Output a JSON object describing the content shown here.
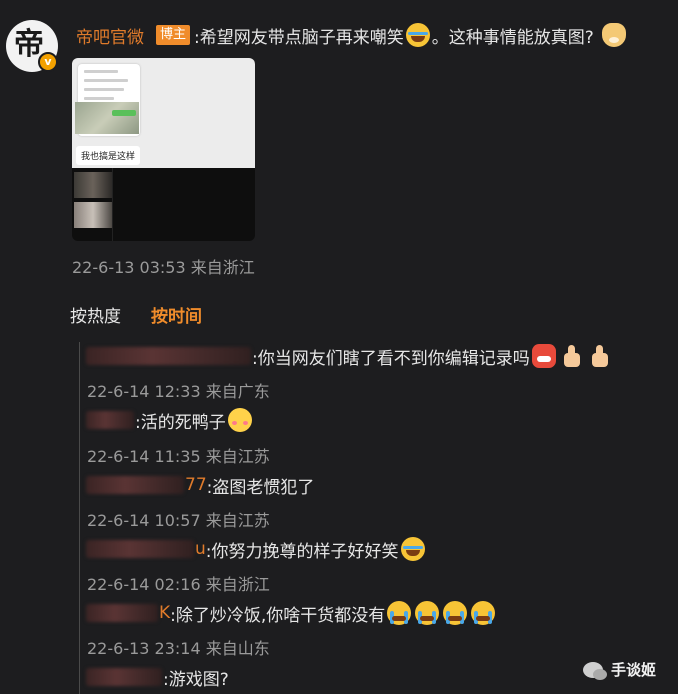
{
  "post": {
    "author": "帝吧官微",
    "badge": "博主",
    "text": ":希望网友带点脑子再来嘲笑",
    "text2": "。这种事情能放真图?",
    "avatar_text": "帝",
    "avatar_badge": "v",
    "image_quote": "我也搞是这样",
    "meta": "22-6-13 03:53 来自浙江",
    "emoji": [
      "laugh-emoji",
      "dog-emoji"
    ]
  },
  "sort_tabs": [
    {
      "label": "按热度",
      "active": false
    },
    {
      "label": "按时间",
      "active": true
    }
  ],
  "replies": [
    {
      "name_tail": "",
      "text": ":你当网友们瞎了看不到你编辑记录吗",
      "meta": "22-6-14 12:33 来自广东",
      "emoji": [
        "angry-emoji",
        "thumbs-up-emoji",
        "thumbs-up-emoji"
      ]
    },
    {
      "name_tail": "",
      "text": ":活的死鸭子",
      "meta": "22-6-14 11:35 来自江苏",
      "emoji": [
        "blush-emoji"
      ]
    },
    {
      "name_tail": "77",
      "text": ":盗图老惯犯了",
      "meta": "22-6-14 10:57 来自江苏",
      "emoji": []
    },
    {
      "name_tail": "u",
      "text": ":你努力挽尊的样子好好笑",
      "meta": "22-6-14 02:16 来自浙江",
      "emoji": [
        "laugh-emoji"
      ]
    },
    {
      "name_tail": "K",
      "text": ":除了炒冷饭,你啥干货都没有",
      "meta": "22-6-13 23:14 来自山东",
      "emoji": [
        "cry-emoji",
        "cry-emoji",
        "cry-emoji",
        "cry-emoji"
      ]
    },
    {
      "name_tail": "",
      "text": ":游戏图?",
      "meta": "",
      "emoji": []
    }
  ],
  "watermark": "手谈姬",
  "colors": {
    "background": "#1d1d1f",
    "accent": "#e07b2b",
    "badge": "#f08c2b",
    "meta": "#9a9a9a"
  }
}
